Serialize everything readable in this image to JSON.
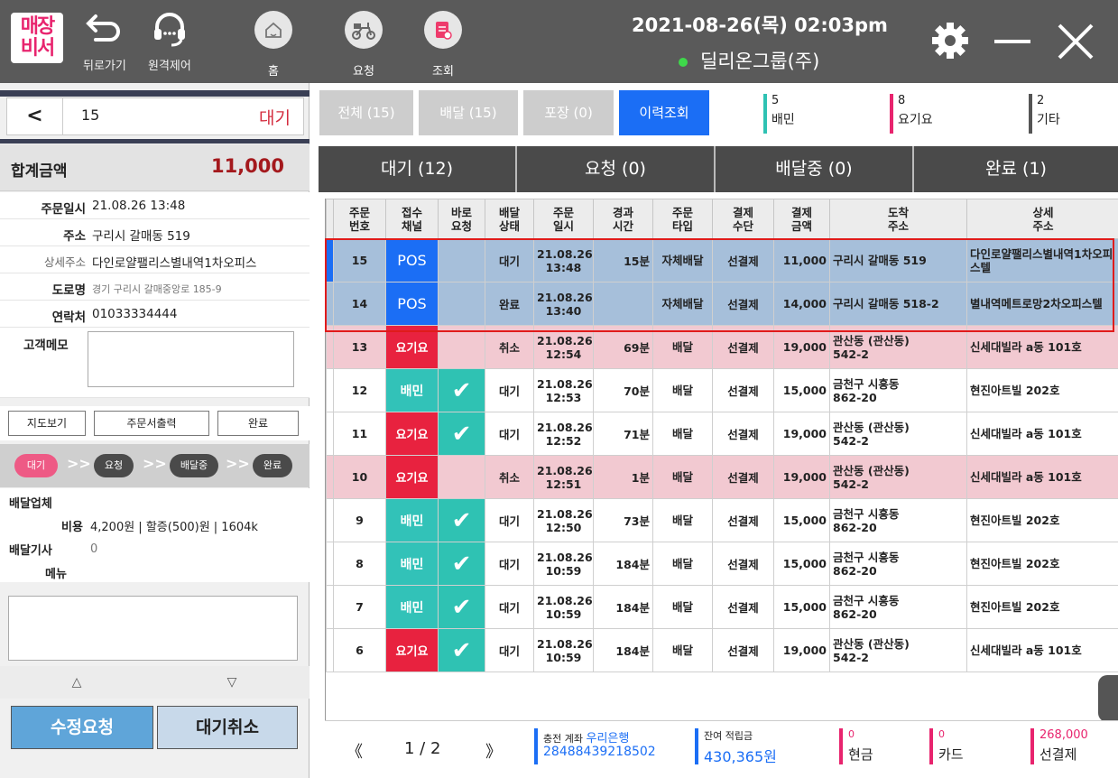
{
  "header": {
    "logo_line1": "매장",
    "logo_line2": "비서",
    "back_label": "뒤로가기",
    "remote_label": "원격제어",
    "home_label": "홈",
    "request_label": "요청",
    "inquiry_label": "조회",
    "datetime": "2021-08-26(목) 02:03pm",
    "company": "딜리온그룹(주)"
  },
  "left_panel": {
    "order_number": "15",
    "order_state": "대기",
    "total_label": "합계금액",
    "total_value": "11,000",
    "fields": {
      "order_date_label": "주문일시",
      "order_date": "21.08.26 13:48",
      "address_label": "주소",
      "address": "구리시 갈매동 519",
      "detail_label": "상세주소",
      "detail": "다인로얄팰리스별내역1차오피스",
      "road_label": "도로명",
      "road": "경기 구리시 갈매중앙로 185-9",
      "phone_label": "연락처",
      "phone": "01033334444",
      "memo_label": "고객메모"
    },
    "buttons": {
      "map": "지도보기",
      "print": "주문서출력",
      "complete": "완료"
    },
    "flow": [
      "대기",
      "요청",
      "배달중",
      "완료"
    ],
    "delivery": {
      "company_label": "배달업체",
      "cost_label": "비용",
      "cost_value": "4,200원 | 할증(500)원 | 1604k",
      "driver_label": "배달기사",
      "driver_value": "0",
      "menu_label": "메뉴"
    },
    "arrow_up": "△",
    "arrow_down": "▽",
    "edit_request": "수정요청",
    "cancel_wait": "대기취소"
  },
  "filter_tabs": [
    {
      "label": "전체 (15)"
    },
    {
      "label": "배달 (15)"
    },
    {
      "label": "포장 (0)"
    },
    {
      "label": "이력조회"
    }
  ],
  "counters": [
    {
      "num": "5",
      "label": "배민",
      "color": "#2fc2b3"
    },
    {
      "num": "8",
      "label": "요기요",
      "color": "#e8246e"
    },
    {
      "num": "2",
      "label": "기타",
      "color": "#555555"
    }
  ],
  "status_tabs": [
    {
      "label": "대기 (12)"
    },
    {
      "label": "요청 (0)"
    },
    {
      "label": "배달중 (0)"
    },
    {
      "label": "완료 (1)"
    }
  ],
  "table": {
    "headers": [
      [
        "주문",
        "번호"
      ],
      [
        "접수",
        "채널"
      ],
      [
        "바로",
        "요청"
      ],
      [
        "배달",
        "상태"
      ],
      [
        "주문",
        "일시"
      ],
      [
        "경과",
        "시간"
      ],
      [
        "주문",
        "타입"
      ],
      [
        "결제",
        "수단"
      ],
      [
        "결제",
        "금액"
      ],
      [
        "도착",
        "주소"
      ],
      [
        "상세",
        "주소"
      ]
    ],
    "rows": [
      {
        "no": "15",
        "channel": "POS",
        "direct": "",
        "status": "대기",
        "date1": "21.08.26",
        "date2": "13:48",
        "elapsed": "15분",
        "type": "자체배달",
        "pay": "선결제",
        "amount": "11,000",
        "addr1": "구리시 갈매동 519",
        "addr2": "",
        "detail": "다인로얄팰리스별내역1차오피스텔"
      },
      {
        "no": "14",
        "channel": "POS",
        "direct": "",
        "status": "완료",
        "date1": "21.08.26",
        "date2": "13:40",
        "elapsed": "",
        "type": "자체배달",
        "pay": "선결제",
        "amount": "14,000",
        "addr1": "구리시 갈매동 518-2",
        "addr2": "",
        "detail": "별내역메트로망2차오피스텔"
      },
      {
        "no": "13",
        "channel": "요기요",
        "direct": "",
        "status": "취소",
        "date1": "21.08.26",
        "date2": "12:54",
        "elapsed": "69분",
        "type": "배달",
        "pay": "선결제",
        "amount": "19,000",
        "addr1": "관산동 (관산동)",
        "addr2": "542-2",
        "detail": "신세대빌라 a동 101호"
      },
      {
        "no": "12",
        "channel": "배민",
        "direct": "✔",
        "status": "대기",
        "date1": "21.08.26",
        "date2": "12:53",
        "elapsed": "70분",
        "type": "배달",
        "pay": "선결제",
        "amount": "15,000",
        "addr1": "금천구 시흥동",
        "addr2": "862-20",
        "detail": "현진아트빌 202호"
      },
      {
        "no": "11",
        "channel": "요기요",
        "direct": "✔",
        "status": "대기",
        "date1": "21.08.26",
        "date2": "12:52",
        "elapsed": "71분",
        "type": "배달",
        "pay": "선결제",
        "amount": "19,000",
        "addr1": "관산동 (관산동)",
        "addr2": "542-2",
        "detail": "신세대빌라 a동 101호"
      },
      {
        "no": "10",
        "channel": "요기요",
        "direct": "",
        "status": "취소",
        "date1": "21.08.26",
        "date2": "12:51",
        "elapsed": "1분",
        "type": "배달",
        "pay": "선결제",
        "amount": "19,000",
        "addr1": "관산동 (관산동)",
        "addr2": "542-2",
        "detail": "신세대빌라 a동 101호"
      },
      {
        "no": "9",
        "channel": "배민",
        "direct": "✔",
        "status": "대기",
        "date1": "21.08.26",
        "date2": "12:50",
        "elapsed": "73분",
        "type": "배달",
        "pay": "선결제",
        "amount": "15,000",
        "addr1": "금천구 시흥동",
        "addr2": "862-20",
        "detail": "현진아트빌 202호"
      },
      {
        "no": "8",
        "channel": "배민",
        "direct": "✔",
        "status": "대기",
        "date1": "21.08.26",
        "date2": "10:59",
        "elapsed": "184분",
        "type": "배달",
        "pay": "선결제",
        "amount": "15,000",
        "addr1": "금천구 시흥동",
        "addr2": "862-20",
        "detail": "현진아트빌 202호"
      },
      {
        "no": "7",
        "channel": "배민",
        "direct": "✔",
        "status": "대기",
        "date1": "21.08.26",
        "date2": "10:59",
        "elapsed": "184분",
        "type": "배달",
        "pay": "선결제",
        "amount": "15,000",
        "addr1": "금천구 시흥동",
        "addr2": "862-20",
        "detail": "현진아트빌 202호"
      },
      {
        "no": "6",
        "channel": "요기요",
        "direct": "✔",
        "status": "대기",
        "date1": "21.08.26",
        "date2": "10:59",
        "elapsed": "184분",
        "type": "배달",
        "pay": "선결제",
        "amount": "19,000",
        "addr1": "관산동 (관산동)",
        "addr2": "542-2",
        "detail": "신세대빌라 a동 101호"
      }
    ]
  },
  "footer": {
    "prev": "《",
    "page": "1 / 2",
    "next": "》",
    "charge_label": "충전 계좌",
    "bank": "우리은행",
    "account": "28488439218502",
    "balance_label": "잔여 적립금",
    "balance": "430,365원",
    "cash_num": "0",
    "cash_label": "현금",
    "card_num": "0",
    "card_label": "카드",
    "prepaid_num": "268,000",
    "prepaid_label": "선결제"
  }
}
